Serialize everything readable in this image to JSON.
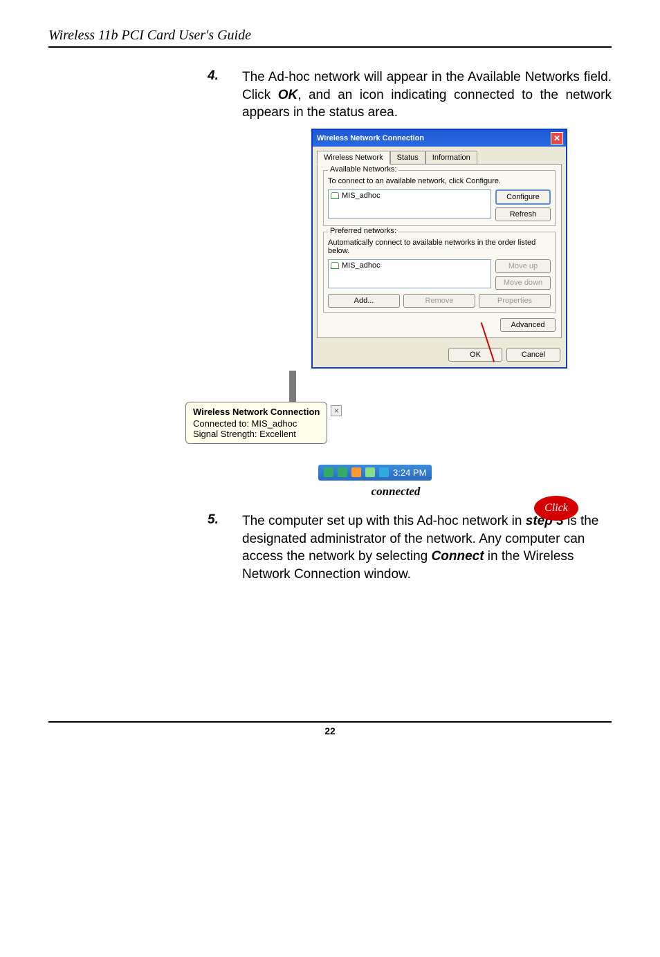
{
  "header": {
    "title": "Wireless 11b PCI Card User's Guide"
  },
  "step4": {
    "num": "4.",
    "text_before": "The Ad-hoc network will appear in the Available Networks field.  Click ",
    "ok": "OK",
    "text_after": ", and an icon indicating connected to the network appears in the status area."
  },
  "dialog": {
    "title": "Wireless Network Connection",
    "tabs": {
      "wireless": "Wireless Network",
      "status": "Status",
      "info": "Information"
    },
    "available": {
      "legend": "Available Networks:",
      "caption": "To connect to an available network, click Configure.",
      "item": "MIS_adhoc",
      "configure": "Configure",
      "refresh": "Refresh"
    },
    "preferred": {
      "legend": "Preferred networks:",
      "caption": "Automatically connect to available networks in the order listed below.",
      "item": "MIS_adhoc",
      "moveup": "Move up",
      "movedown": "Move down",
      "add": "Add...",
      "remove": "Remove",
      "properties": "Properties"
    },
    "advanced": "Advanced",
    "ok": "OK",
    "cancel": "Cancel"
  },
  "click_label": "Click",
  "balloon": {
    "title": "Wireless Network Connection",
    "line1": "Connected to: MIS_adhoc",
    "line2": "Signal Strength: Excellent"
  },
  "systray": {
    "time": "3:24 PM"
  },
  "caption": "connected",
  "step5": {
    "num": "5.",
    "part1": "The computer set up with this Ad-hoc network in ",
    "step3": "step 3",
    "part2": " is the designated administrator of the network.  Any computer can access the network by selecting ",
    "connect": "Connect",
    "part3": " in the Wireless Network Connection window."
  },
  "pagenum": "22"
}
